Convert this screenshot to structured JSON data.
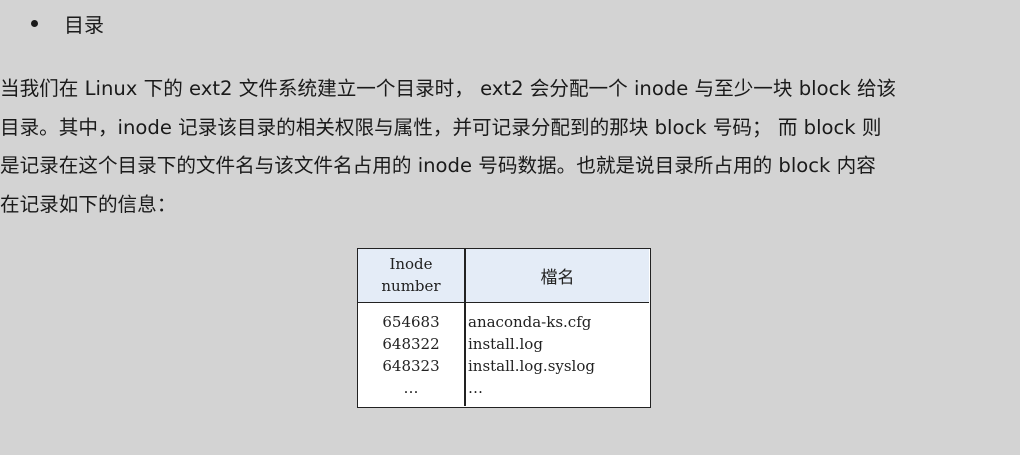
{
  "bullet": {
    "label": "目录"
  },
  "paragraph": {
    "lines": [
      "当我们在 Linux 下的 ext2 文件系统建立一个目录时， ext2 会分配一个 inode 与至少一块 block 给该",
      "目录。其中，inode 记录该目录的相关权限与属性，并可记录分配到的那块 block 号码； 而 block 则",
      "是记录在这个目录下的文件名与该文件名占用的 inode 号码数据。也就是说目录所占用的 block 内容",
      "在记录如下的信息："
    ]
  },
  "table": {
    "header": {
      "col1_line1": "Inode",
      "col1_line2": "number",
      "col2": "檔名"
    },
    "rows": [
      {
        "inode": "654683",
        "filename": "anaconda-ks.cfg"
      },
      {
        "inode": "648322",
        "filename": "install.log"
      },
      {
        "inode": "648323",
        "filename": "install.log.syslog"
      },
      {
        "inode": "…",
        "filename": "…"
      }
    ]
  }
}
